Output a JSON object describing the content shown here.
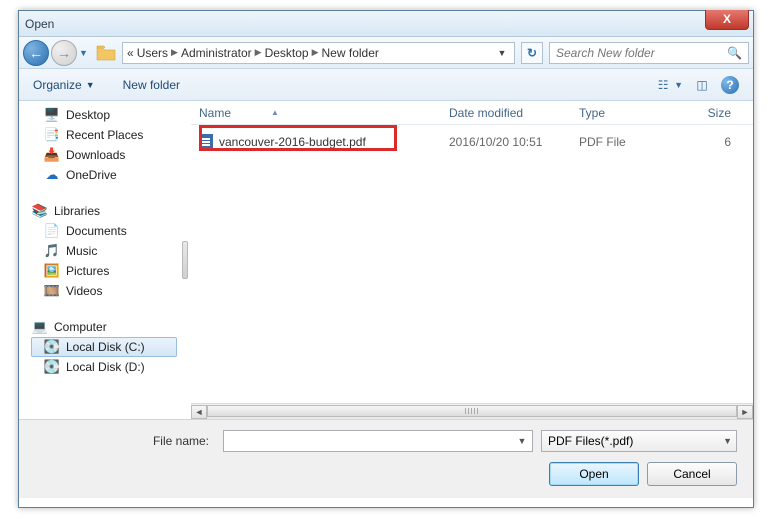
{
  "window": {
    "title": "Open"
  },
  "nav": {
    "breadcrumb": [
      "Users",
      "Administrator",
      "Desktop",
      "New folder"
    ],
    "search_placeholder": "Search New folder"
  },
  "toolbar": {
    "organize": "Organize",
    "new_folder": "New folder"
  },
  "tree": {
    "favorites": [
      {
        "icon": "desktop-icon",
        "label": "Desktop"
      },
      {
        "icon": "recent-icon",
        "label": "Recent Places"
      },
      {
        "icon": "downloads-icon",
        "label": "Downloads"
      },
      {
        "icon": "onedrive-icon",
        "label": "OneDrive"
      }
    ],
    "libraries_label": "Libraries",
    "libraries": [
      {
        "icon": "documents-icon",
        "label": "Documents"
      },
      {
        "icon": "music-icon",
        "label": "Music"
      },
      {
        "icon": "pictures-icon",
        "label": "Pictures"
      },
      {
        "icon": "videos-icon",
        "label": "Videos"
      }
    ],
    "computer_label": "Computer",
    "computer": [
      {
        "icon": "disk-icon",
        "label": "Local Disk (C:)",
        "selected": true
      },
      {
        "icon": "disk-icon",
        "label": "Local Disk (D:)"
      }
    ]
  },
  "columns": {
    "name": "Name",
    "date": "Date modified",
    "type": "Type",
    "size": "Size"
  },
  "files": [
    {
      "name": "vancouver-2016-budget.pdf",
      "date": "2016/10/20 10:51",
      "type": "PDF File",
      "size": "6"
    }
  ],
  "bottom": {
    "filename_label": "File name:",
    "filename_value": "",
    "filter": "PDF Files(*.pdf)",
    "open": "Open",
    "cancel": "Cancel"
  }
}
